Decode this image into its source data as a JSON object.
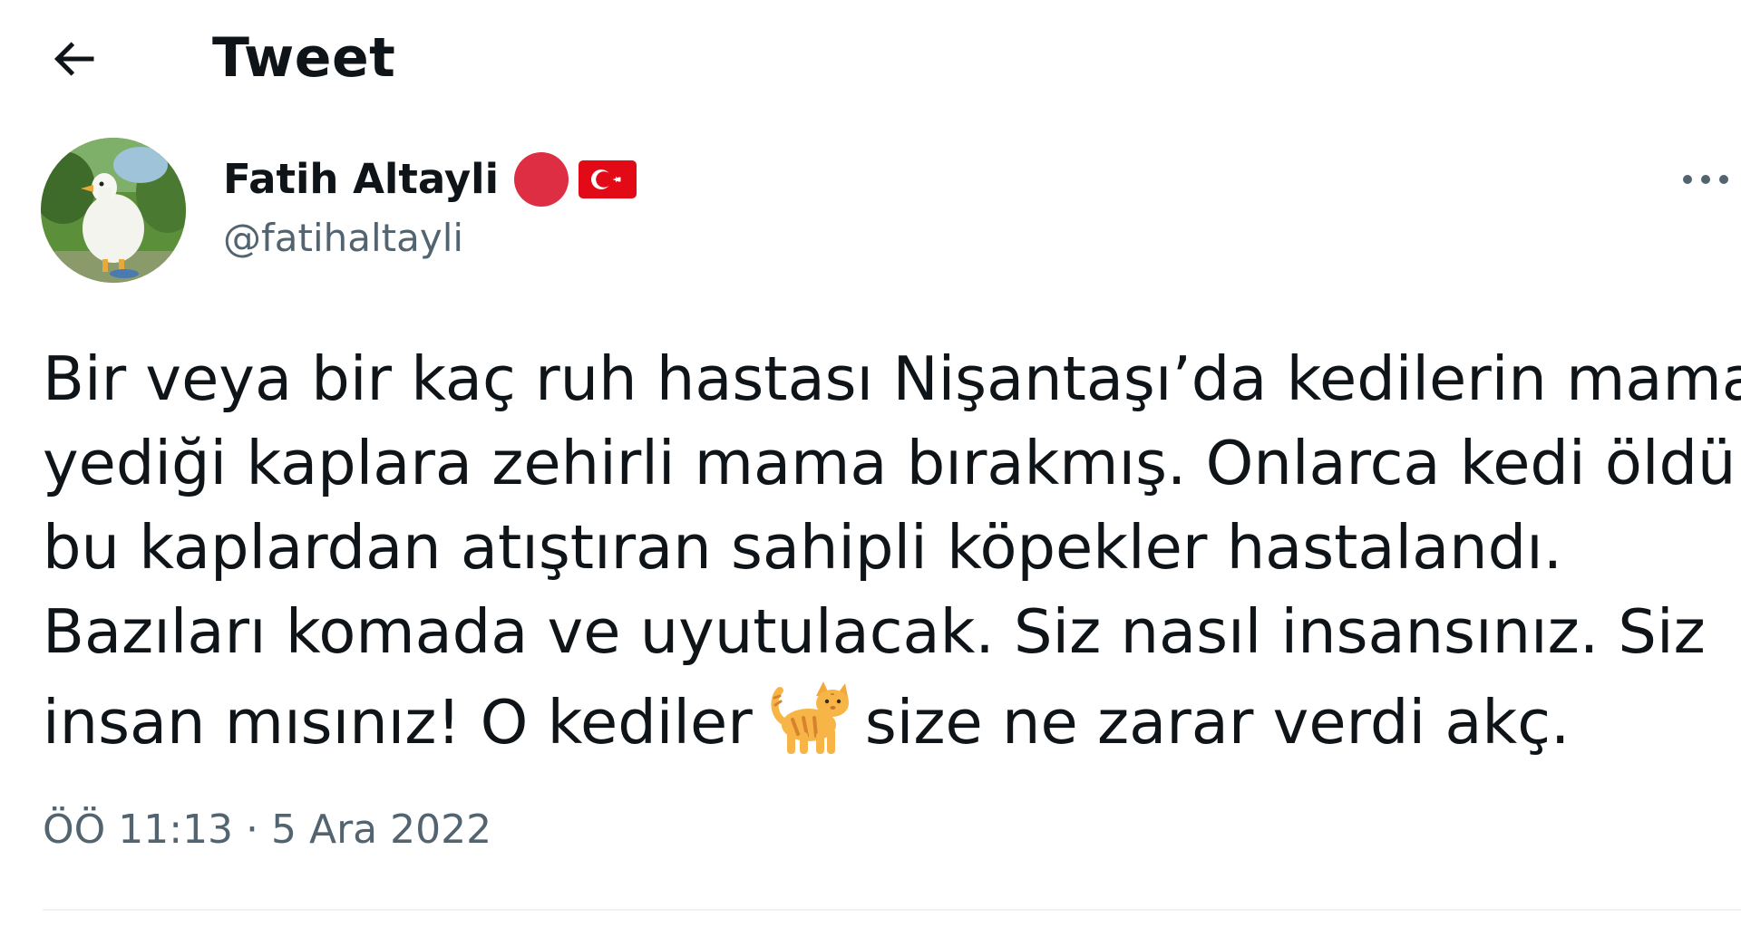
{
  "header": {
    "back_icon": "arrow-left-icon",
    "title": "Tweet"
  },
  "author": {
    "avatar_icon": "avatar-goose-image",
    "display_name": "Fatih Altayli",
    "badges": [
      {
        "icon": "red-circle-icon",
        "color": "#dd2e44"
      },
      {
        "icon": "turkey-flag-icon",
        "color": "#e30a17"
      }
    ],
    "handle": "@fatihaltayli"
  },
  "more_icon": "more-horizontal-icon",
  "tweet": {
    "lines": [
      "Bir veya bir kaç ruh hastası Nişantaşı’da kedilerin mama",
      "yediği kaplara zehirli mama bırakmış. Onlarca kedi öldü",
      "bu kaplardan atıştıran sahipli köpekler hastalandı.",
      "Bazıları komada ve uyutulacak. Siz nasıl insansınız. Siz"
    ],
    "last_line_before_emoji": "insan mısınız! O kediler",
    "emoji_icon": "cat-emoji-icon",
    "last_line_after_emoji": "size ne zarar verdi akç."
  },
  "meta": {
    "timestamp": "ÖÖ 11:13 · 5 Ara 2022"
  },
  "colors": {
    "text": "#0f1419",
    "secondary": "#536471",
    "divider": "#eff3f4"
  }
}
